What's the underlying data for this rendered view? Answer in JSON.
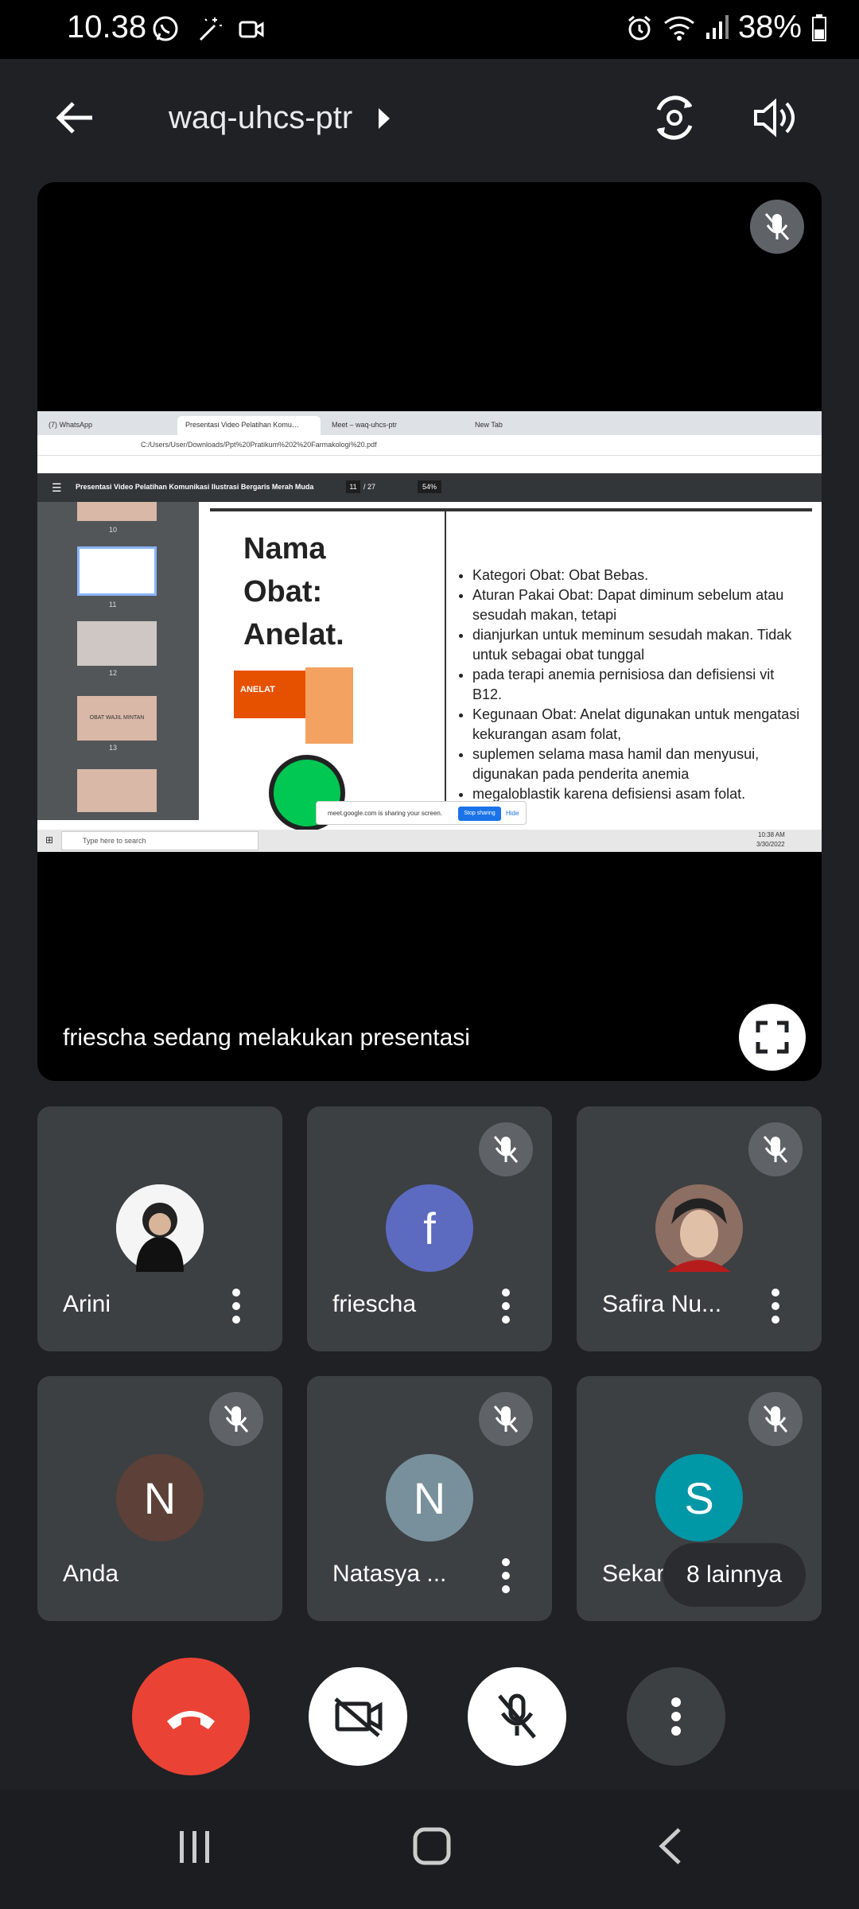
{
  "status_bar": {
    "time": "10.38",
    "battery": "38%"
  },
  "header": {
    "meeting_code": "waq-uhcs-ptr"
  },
  "presentation": {
    "presenting_text": "friescha sedang melakukan presentasi",
    "screen": {
      "tabs": [
        "(7) WhatsApp",
        "Presentasi Video Pelatihan Komu…",
        "Meet – waq-uhcs-ptr",
        "New Tab"
      ],
      "url": "C:/Users/User/Downloads/Ppt%20Pratikum%202%20Farmakologi%20.pdf",
      "pdf_title": "Presentasi Video Pelatihan Komunikasi Ilustrasi Bergaris Merah Muda",
      "page_indicator": "11",
      "page_total": "/ 27",
      "zoom": "54%",
      "thumbnails": [
        "10",
        "11",
        "12",
        "13"
      ],
      "thumb_13_text": "OBAT WAJIL MINTAN",
      "slide_title": "Nama\nObat:\nAnelat.",
      "product_label": "ANELAT",
      "bullets": [
        "Kategori Obat: Obat Bebas.",
        "Aturan Pakai Obat: Dapat diminum sebelum atau sesudah makan, tetapi",
        "dianjurkan untuk meminum sesudah makan. Tidak untuk sebagai obat tunggal",
        "pada terapi anemia pernisiosa dan defisiensi vit B12.",
        "Kegunaan Obat: Anelat digunakan untuk mengatasi kekurangan asam folat,",
        "suplemen selama masa hamil dan menyusui, digunakan pada penderita anemia",
        "megaloblastik karena defisiensi asam folat."
      ],
      "share_notice": "meet.google.com is sharing your screen.",
      "stop_sharing": "Stop sharing",
      "hide": "Hide",
      "search_placeholder": "Type here to search",
      "clock_time": "10:38 AM",
      "clock_date": "3/30/2022"
    }
  },
  "participants": [
    {
      "name": "Arini",
      "initial": "",
      "color": "#ffffff",
      "muted": false
    },
    {
      "name": "friescha",
      "initial": "f",
      "color": "#5c6bc0",
      "muted": true
    },
    {
      "name": "Safira Nu...",
      "initial": "",
      "color": "#6d4c41",
      "muted": true
    },
    {
      "name": "Anda",
      "initial": "N",
      "color": "#5d4037",
      "muted": true
    },
    {
      "name": "Natasya ...",
      "initial": "N",
      "color": "#78909c",
      "muted": true
    },
    {
      "name": "Sekar",
      "initial": "S",
      "color": "#0097a7",
      "muted": true
    }
  ],
  "others_chip": "8 lainnya",
  "colors": {
    "end_call": "#ea4335",
    "tile_bg": "#3c4043",
    "background": "#202124"
  }
}
